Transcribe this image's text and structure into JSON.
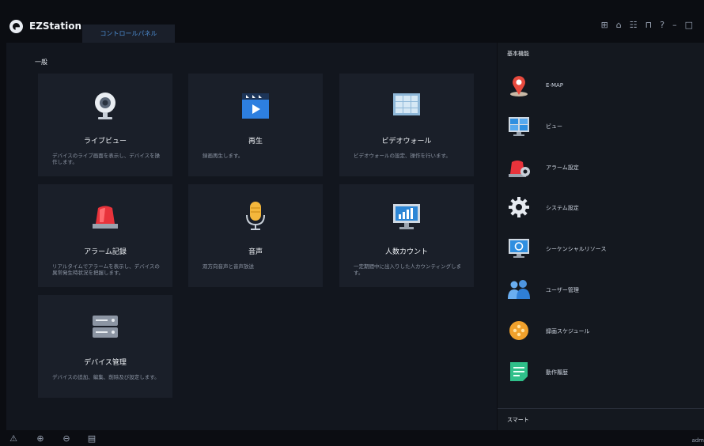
{
  "app": {
    "title": "EZStation"
  },
  "tabs": [
    {
      "label": "コントロールパネル"
    }
  ],
  "window": {
    "icons": [
      "grid-icon",
      "shirt-icon",
      "users-icon",
      "lock-icon",
      "help-icon",
      "minimize-icon",
      "maximize-icon"
    ]
  },
  "main": {
    "section_title": "一般",
    "cards": [
      {
        "title": "ライブビュー",
        "desc": "デバイスのライブ画面を表示し、デバイスを操作します。",
        "icon": "camera-icon"
      },
      {
        "title": "再生",
        "desc": "録画再生します。",
        "icon": "playback-icon"
      },
      {
        "title": "ビデオウォール",
        "desc": "ビデオウォールの設定、操作を行います。",
        "icon": "video-wall-icon"
      },
      {
        "title": "アラーム記録",
        "desc": "リアルタイムでアラームを表示し、デバイスの異常発生時状況を把握します。",
        "icon": "alarm-light-icon"
      },
      {
        "title": "音声",
        "desc": "双方向音声と音声放送",
        "icon": "microphone-icon"
      },
      {
        "title": "人数カウント",
        "desc": "一定期間中に出入りした人カウンティングします。",
        "icon": "people-count-icon"
      },
      {
        "title": "デバイス管理",
        "desc": "デバイスの追加、編集、削除及び設定します。",
        "icon": "device-server-icon"
      }
    ]
  },
  "sidebar": {
    "title": "基本機能",
    "items": [
      {
        "label": "E-MAP",
        "icon": "map-pin-icon"
      },
      {
        "label": "ビュー",
        "icon": "view-icon"
      },
      {
        "label": "アラーム設定",
        "icon": "alarm-settings-icon"
      },
      {
        "label": "システム設定",
        "icon": "gear-icon"
      },
      {
        "label": "シーケンシャルリソース",
        "icon": "sequence-icon"
      },
      {
        "label": "ユーザー管理",
        "icon": "user-group-icon"
      },
      {
        "label": "録画スケジュール",
        "icon": "schedule-icon"
      },
      {
        "label": "動作履歴",
        "icon": "log-icon"
      }
    ],
    "bottom_title": "スマート"
  },
  "statusbar": {
    "icons": [
      "warning-icon",
      "upload-icon",
      "download-icon",
      "clipboard-icon"
    ],
    "user": "adm"
  },
  "colors": {
    "accent": "#4e8fd6",
    "card_bg": "#1a1f29",
    "sidebar_bg": "#14181f"
  }
}
